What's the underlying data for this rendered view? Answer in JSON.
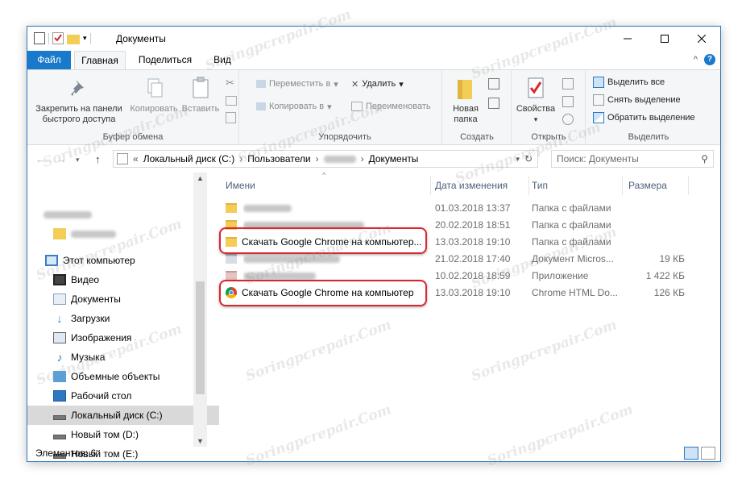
{
  "window": {
    "title": "Документы",
    "controls": [
      "minimize-icon",
      "maximize-icon",
      "close-icon"
    ]
  },
  "ribbon_tabs": [
    {
      "label": "Файл"
    },
    {
      "label": "Главная"
    },
    {
      "label": "Поделиться"
    },
    {
      "label": "Вид"
    }
  ],
  "ribbon": {
    "clipboard": {
      "pin_label": "Закрепить на панели быстрого доступа",
      "copy_label": "Копировать",
      "paste_label": "Вставить",
      "group_label": "Буфер обмена"
    },
    "organize": {
      "move_label": "Переместить в",
      "copy_to_label": "Копировать в",
      "delete_label": "Удалить",
      "rename_label": "Переименовать",
      "group_label": "Упорядочить"
    },
    "create": {
      "new_folder_label": "Новая папка",
      "group_label": "Создать"
    },
    "open": {
      "properties_label": "Свойства",
      "group_label": "Открыть"
    },
    "select": {
      "select_all_label": "Выделить все",
      "deselect_label": "Снять выделение",
      "invert_label": "Обратить выделение",
      "group_label": "Выделить"
    }
  },
  "address": {
    "segments": [
      "Локальный диск (C:)",
      "Пользователи",
      "Документы"
    ],
    "search_placeholder": "Поиск: Документы"
  },
  "nav": {
    "items": [
      {
        "label": "Этот компьютер",
        "icon": "computer-icon"
      },
      {
        "label": "Видео",
        "icon": "video-icon"
      },
      {
        "label": "Документы",
        "icon": "documents-icon"
      },
      {
        "label": "Загрузки",
        "icon": "downloads-icon"
      },
      {
        "label": "Изображения",
        "icon": "pictures-icon"
      },
      {
        "label": "Музыка",
        "icon": "music-icon"
      },
      {
        "label": "Объемные объекты",
        "icon": "3d-objects-icon"
      },
      {
        "label": "Рабочий стол",
        "icon": "desktop-icon"
      },
      {
        "label": "Локальный диск (C:)",
        "icon": "drive-icon"
      },
      {
        "label": "Новый том (D:)",
        "icon": "drive-icon"
      },
      {
        "label": "Новый том (E:)",
        "icon": "drive-icon"
      }
    ]
  },
  "columns": {
    "name": "Имени",
    "date": "Дата изменения",
    "type": "Тип",
    "size": "Размера"
  },
  "files": [
    {
      "name": "",
      "date": "01.03.2018 13:37",
      "type": "Папка с файлами",
      "size": ""
    },
    {
      "name": "",
      "date": "20.02.2018 18:51",
      "type": "Папка с файлами",
      "size": ""
    },
    {
      "name": "Скачать Google Chrome на компьютер...",
      "date": "13.03.2018 19:10",
      "type": "Папка с файлами",
      "size": ""
    },
    {
      "name": "",
      "date": "21.02.2018 17:40",
      "type": "Документ Micros...",
      "size": "19 КБ"
    },
    {
      "name": "",
      "date": "10.02.2018 18:59",
      "type": "Приложение",
      "size": "1 422 КБ"
    },
    {
      "name": "Скачать Google Chrome на компьютер",
      "date": "13.03.2018 19:10",
      "type": "Chrome HTML Do...",
      "size": "126 КБ"
    }
  ],
  "status": {
    "items_count": "Элементов: 6"
  },
  "watermark": "Soringpcrepair.Com",
  "colors": {
    "accent": "#1979ca",
    "highlight": "#d9272e",
    "folder": "#f4cd56"
  }
}
